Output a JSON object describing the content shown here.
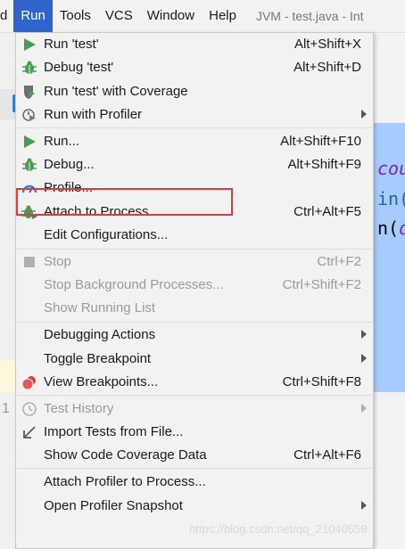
{
  "menubar": {
    "first_fragment": "d",
    "items": [
      "Run",
      "Tools",
      "VCS",
      "Window",
      "Help"
    ],
    "title": "JVM - test.java - Int"
  },
  "editor": {
    "fragment1": "cou",
    "fragment2": "in(",
    "fragment3a": "n(",
    "fragment3b": "d",
    "gutter_number": "1"
  },
  "menu": {
    "items": [
      {
        "label": "Run 'test'",
        "shortcut": "Alt+Shift+X",
        "icon": "run-icon"
      },
      {
        "label": "Debug 'test'",
        "shortcut": "Alt+Shift+D",
        "icon": "debug-icon"
      },
      {
        "label": "Run 'test' with Coverage",
        "shortcut": "",
        "icon": "coverage-icon"
      },
      {
        "label": "Run with Profiler",
        "shortcut": "",
        "icon": "profiler-icon",
        "submenu": true
      },
      {
        "label": "Run...",
        "shortcut": "Alt+Shift+F10",
        "icon": "run-icon"
      },
      {
        "label": "Debug...",
        "shortcut": "Alt+Shift+F9",
        "icon": "debug-icon"
      },
      {
        "label": "Profile...",
        "shortcut": "",
        "icon": "gauge-icon"
      },
      {
        "label": "Attach to Process...",
        "shortcut": "Ctrl+Alt+F5",
        "icon": "attach-debug-icon"
      },
      {
        "label": "Edit Configurations...",
        "shortcut": "",
        "icon": ""
      },
      {
        "label": "Stop",
        "shortcut": "Ctrl+F2",
        "icon": "stop-icon",
        "disabled": true
      },
      {
        "label": "Stop Background Processes...",
        "shortcut": "Ctrl+Shift+F2",
        "icon": "",
        "disabled": true
      },
      {
        "label": "Show Running List",
        "shortcut": "",
        "icon": "",
        "disabled": true
      },
      {
        "label": "Debugging Actions",
        "shortcut": "",
        "icon": "",
        "submenu": true
      },
      {
        "label": "Toggle Breakpoint",
        "shortcut": "",
        "icon": "",
        "submenu": true
      },
      {
        "label": "View Breakpoints...",
        "shortcut": "Ctrl+Shift+F8",
        "icon": "breakpoints-icon"
      },
      {
        "label": "Test History",
        "shortcut": "",
        "icon": "clock-icon",
        "disabled": true,
        "submenu": true
      },
      {
        "label": "Import Tests from File...",
        "shortcut": "",
        "icon": "import-arrow-icon"
      },
      {
        "label": "Show Code Coverage Data",
        "shortcut": "Ctrl+Alt+F6",
        "icon": ""
      },
      {
        "label": "Attach Profiler to Process...",
        "shortcut": "",
        "icon": ""
      },
      {
        "label": "Open Profiler Snapshot",
        "shortcut": "",
        "icon": "",
        "submenu": true
      }
    ]
  },
  "watermark": "https://blog.csdn.net/qq_21040559",
  "colors": {
    "menu_bg": "#f2f2f2",
    "active_menu": "#2f65ca",
    "run_green": "#499c54",
    "highlight_box": "#e53935",
    "editor_selection": "#a6ccff"
  }
}
